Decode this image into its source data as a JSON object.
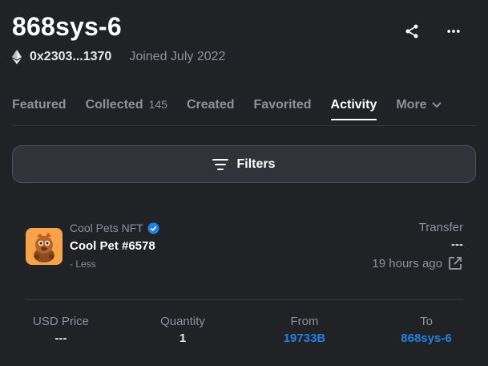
{
  "profile": {
    "name": "868sys-6",
    "address": "0x2303...1370",
    "joined": "Joined July 2022"
  },
  "icons": {
    "share": "share-icon",
    "more": "more-dots-icon",
    "eth": "ethereum-icon"
  },
  "tabs": [
    {
      "label": "Featured",
      "count": ""
    },
    {
      "label": "Collected",
      "count": "145"
    },
    {
      "label": "Created",
      "count": ""
    },
    {
      "label": "Favorited",
      "count": ""
    },
    {
      "label": "Activity",
      "count": "",
      "active": true
    },
    {
      "label": "More",
      "count": ""
    }
  ],
  "filters": {
    "label": "Filters"
  },
  "activity": {
    "collection": "Cool Pets NFT",
    "item": "Cool Pet #6578",
    "toggle": "- Less",
    "event_type": "Transfer",
    "price": "---",
    "time": "19 hours ago",
    "details": {
      "usd_price_label": "USD Price",
      "usd_price_value": "---",
      "quantity_label": "Quantity",
      "quantity_value": "1",
      "from_label": "From",
      "from_value": "19733B",
      "to_label": "To",
      "to_value": "868sys-6"
    }
  },
  "colors": {
    "background": "#202225",
    "accent_link": "#2081e2",
    "muted_text": "#8a939b",
    "verified_badge": "#2081e2"
  }
}
